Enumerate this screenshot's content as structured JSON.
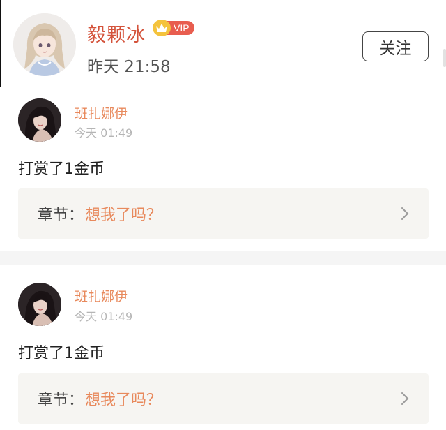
{
  "author": {
    "name": "毅颗冰",
    "vip_label": "VIP",
    "time": "昨天 21:58",
    "follow_label": "关注"
  },
  "rewards": [
    {
      "user_name": "班扎娜伊",
      "time": "今天 01:49",
      "text": "打赏了1金币",
      "chapter_label": "章节：",
      "chapter_title": "想我了吗？"
    },
    {
      "user_name": "班扎娜伊",
      "time": "今天 01:49",
      "text": "打赏了1金币",
      "chapter_label": "章节：",
      "chapter_title": "想我了吗？"
    }
  ],
  "colors": {
    "author_name": "#d4533b",
    "user_name": "#e8895c",
    "chapter_title": "#e8895c",
    "vip_badge": "#e85d4f",
    "vip_crown": "#f4c33d"
  },
  "icons": [
    "crown-icon",
    "chevron-right-icon"
  ]
}
